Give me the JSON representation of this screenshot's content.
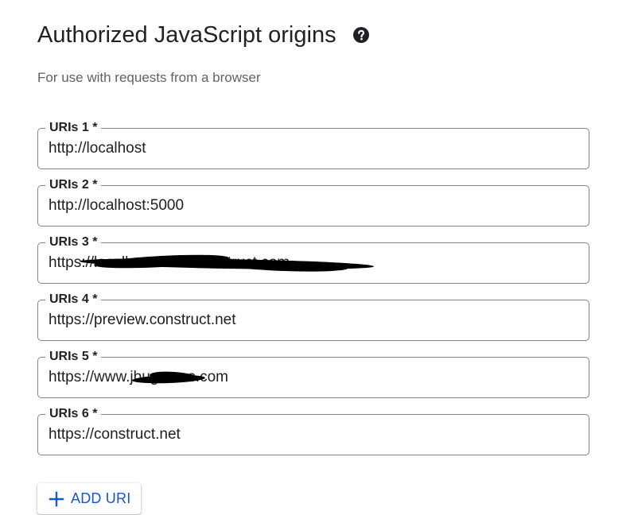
{
  "section": {
    "title": "Authorized JavaScript origins",
    "help_icon": "help-circle-icon",
    "subtitle": "For use with requests from a browser"
  },
  "uris": [
    {
      "label": "URIs 1 *",
      "value": "http://localhost"
    },
    {
      "label": "URIs 2 *",
      "value": "http://localhost:5000"
    },
    {
      "label": "URIs 3 *",
      "value": "https://localhost:5000.construct.com"
    },
    {
      "label": "URIs 4 *",
      "value": "https://preview.construct.net"
    },
    {
      "label": "URIs 5 *",
      "value": "https://www.jbugames.com"
    },
    {
      "label": "URIs 6 *",
      "value": "https://construct.net"
    }
  ],
  "add_button": {
    "icon": "plus-icon",
    "label": "ADD URI"
  },
  "colors": {
    "text": "#202124",
    "secondary_text": "#5f6368",
    "border": "#80868b",
    "accent": "#1a56c4"
  }
}
